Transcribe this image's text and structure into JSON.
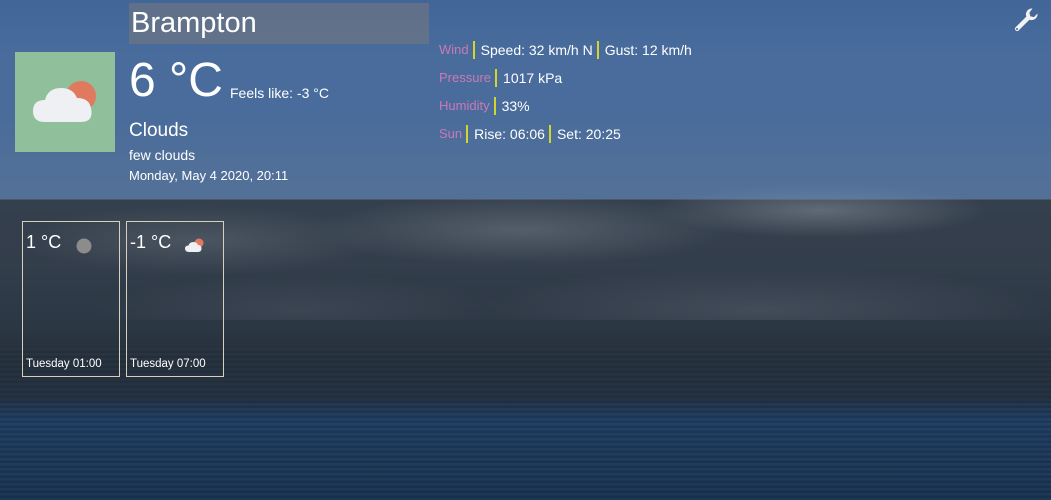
{
  "current": {
    "city": "Brampton",
    "temperature": "6 °C",
    "feels_like": "Feels like: -3 °C",
    "condition": "Clouds",
    "description": "few clouds",
    "datetime": "Monday, May 4 2020, 20:11",
    "icon": "cloud-with-sun-icon"
  },
  "details": {
    "wind": {
      "label": "Wind",
      "speed": "Speed: 32 km/h N",
      "gust": "Gust: 12 km/h"
    },
    "pressure": {
      "label": "Pressure",
      "value": "1017 kPa"
    },
    "humidity": {
      "label": "Humidity",
      "value": "33%"
    },
    "sun": {
      "label": "Sun",
      "rise": "Rise: 06:06",
      "set": "Set: 20:25"
    }
  },
  "forecast": [
    {
      "temperature": "1 °C",
      "time": "Tuesday 01:00",
      "icon": "clear-night-icon"
    },
    {
      "temperature": "-1 °C",
      "time": "Tuesday 07:00",
      "icon": "cloud-with-sun-icon"
    }
  ],
  "toolbar": {
    "settings_icon": "wrench-icon"
  },
  "colors": {
    "label": "#c97ab5",
    "separator": "#d4d42a",
    "icon_bg": "#8fbf9b",
    "sun": "#e07a5f"
  }
}
